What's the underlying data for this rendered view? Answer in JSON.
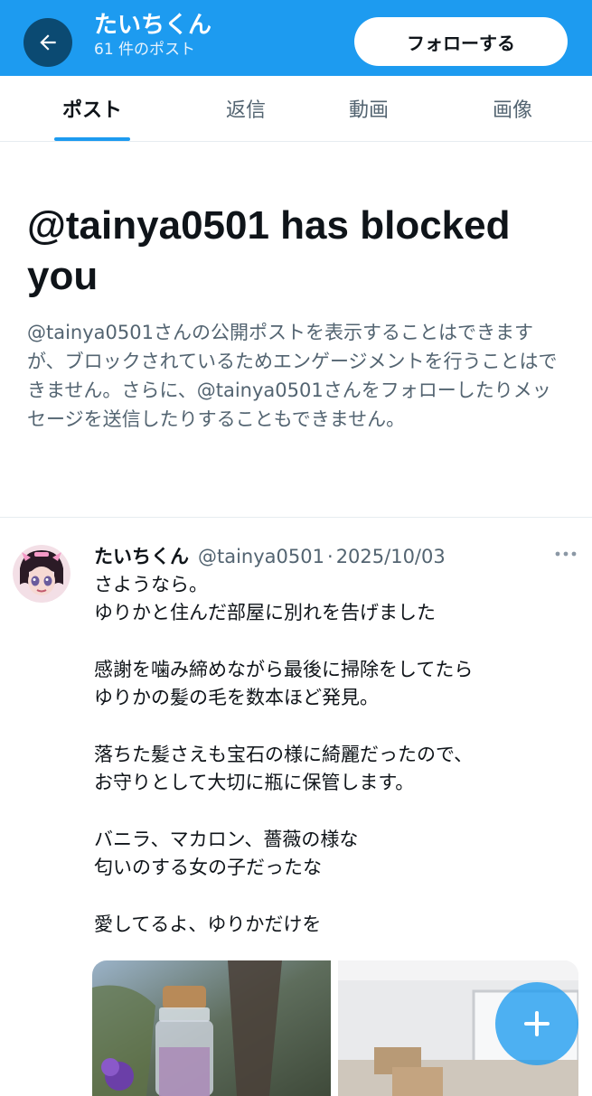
{
  "header": {
    "name": "たいちくん",
    "post_count": "61 件のポスト",
    "follow_label": "フォローする",
    "back_icon": "arrow-left-icon"
  },
  "tabs": [
    {
      "label": "ポスト",
      "active": true
    },
    {
      "label": "返信",
      "active": false
    },
    {
      "label": "動画",
      "active": false
    },
    {
      "label": "画像",
      "active": false
    }
  ],
  "blocked": {
    "title": "@tainya0501 has blocked you",
    "description": "@tainya0501さんの公開ポストを表示することはできますが、ブロックされているためエンゲージメントを行うことはできません。さらに、@tainya0501さんをフォローしたりメッセージを送信したりすることもできません。"
  },
  "post": {
    "name": "たいちくん",
    "handle": "@tainya0501",
    "separator": "·",
    "date": "2025/10/03",
    "more_icon": "more-horizontal-icon",
    "lines": [
      "さようなら。",
      "ゆりかと住んだ部屋に別れを告げました",
      "",
      "感謝を噛み締めながら最後に掃除をしてたら",
      "ゆりかの髪の毛を数本ほど発見。",
      "",
      "落ちた髪さえも宝石の様に綺麗だったので、",
      "お守りとして大切に瓶に保管します。",
      "",
      "バニラ、マカロン、薔薇の様な",
      "匂いのする女の子だったな",
      "",
      "愛してるよ、ゆりかだけを"
    ]
  },
  "fab": {
    "icon": "plus-icon"
  },
  "colors": {
    "accent": "#1d9bf0",
    "back_button": "#0b4a72",
    "secondary_text": "#536471",
    "primary_text": "#0f1419"
  }
}
